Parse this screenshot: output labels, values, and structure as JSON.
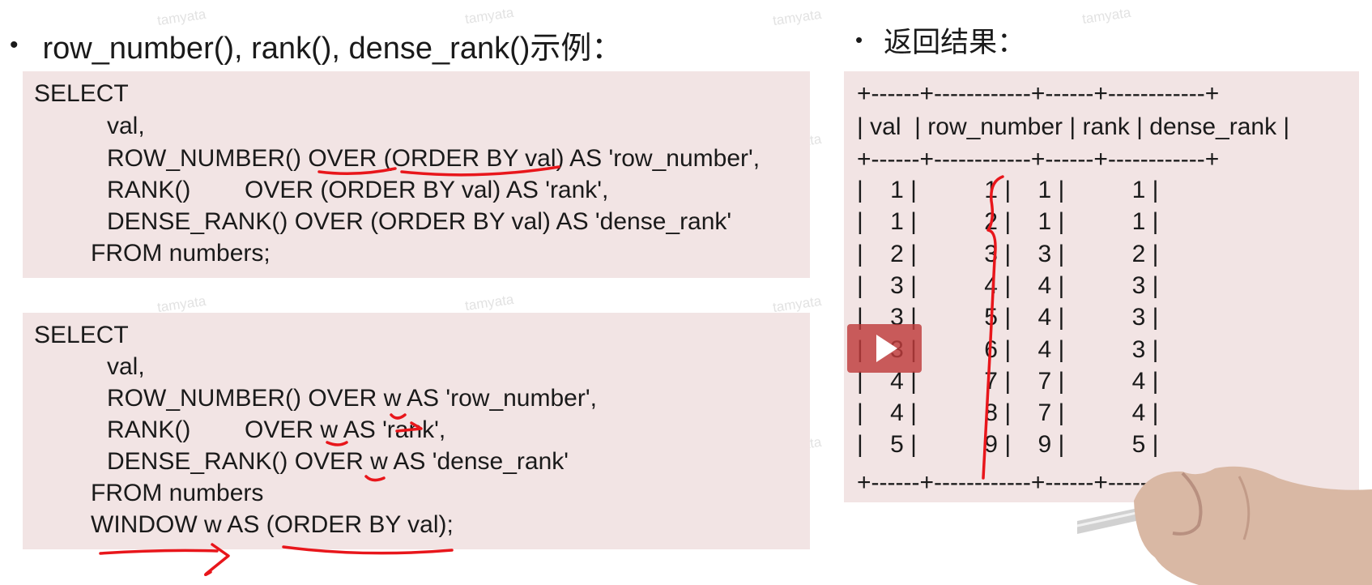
{
  "left_heading": {
    "bullet": "•",
    "text": "row_number(), rank(), dense_rank()示例："
  },
  "right_heading": {
    "bullet": "•",
    "text": "返回结果："
  },
  "code_block_1": {
    "lines": [
      "SELECT",
      "val,",
      "ROW_NUMBER() OVER (ORDER BY val) AS 'row_number',",
      "RANK()        OVER (ORDER BY val) AS 'rank',",
      "DENSE_RANK() OVER (ORDER BY val) AS 'dense_rank'",
      "FROM numbers;"
    ]
  },
  "code_block_2": {
    "lines": [
      "SELECT",
      "val,",
      "ROW_NUMBER() OVER w AS 'row_number',",
      "RANK()        OVER w AS 'rank',",
      "DENSE_RANK() OVER w AS 'dense_rank'",
      "FROM numbers",
      "WINDOW w AS (ORDER BY val);"
    ]
  },
  "result_table": {
    "border": "+------+------------+------+------------+",
    "header": "| val  | row_number | rank | dense_rank |",
    "columns": [
      "val",
      "row_number",
      "rank",
      "dense_rank"
    ],
    "rows": [
      [
        "1",
        "1",
        "1",
        "1"
      ],
      [
        "1",
        "2",
        "1",
        "1"
      ],
      [
        "2",
        "3",
        "3",
        "2"
      ],
      [
        "3",
        "4",
        "4",
        "3"
      ],
      [
        "3",
        "5",
        "4",
        "3"
      ],
      [
        "3",
        "6",
        "4",
        "3"
      ],
      [
        "4",
        "7",
        "7",
        "4"
      ],
      [
        "4",
        "8",
        "7",
        "4"
      ],
      [
        "5",
        "9",
        "9",
        "5"
      ]
    ]
  },
  "watermark_text": "tamyata",
  "colors": {
    "code_background": "#f2e4e4",
    "annotation_ink": "#e8161b",
    "play_button": "#be3c3c"
  }
}
